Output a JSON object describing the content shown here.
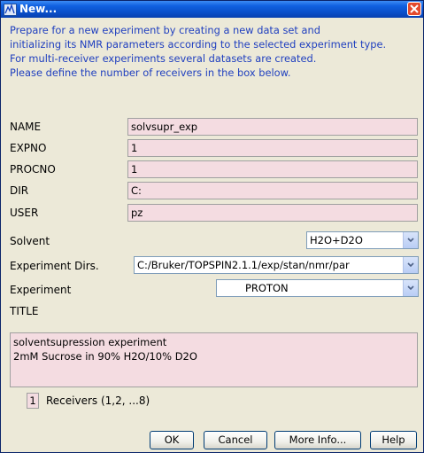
{
  "window": {
    "title": "New..."
  },
  "intro": {
    "lines": [
      "Prepare for a new experiment by creating a new data set and",
      "initializing its NMR parameters according to the selected experiment type.",
      "For multi-receiver experiments several datasets are created.",
      "Please define the number of receivers in the box below."
    ]
  },
  "form": {
    "name": {
      "label": "NAME",
      "value": "solvsupr_exp"
    },
    "expno": {
      "label": "EXPNO",
      "value": "1"
    },
    "procno": {
      "label": "PROCNO",
      "value": "1"
    },
    "dir": {
      "label": "DIR",
      "value": "C:"
    },
    "user": {
      "label": "USER",
      "value": "pz"
    },
    "solvent": {
      "label": "Solvent",
      "value": "H2O+D2O"
    },
    "experiment_dirs": {
      "label": "Experiment Dirs.",
      "value": "C:/Bruker/TOPSPIN2.1.1/exp/stan/nmr/par"
    },
    "experiment": {
      "label": "Experiment",
      "value": "PROTON"
    },
    "title": {
      "label": "TITLE",
      "lines": [
        "solventsupression experiment",
        "2mM Sucrose in 90% H2O/10% D2O"
      ]
    },
    "receivers": {
      "value": "1",
      "label": "Receivers (1,2, ...8)"
    }
  },
  "buttons": {
    "ok": "OK",
    "cancel": "Cancel",
    "more_info": "More Info...",
    "help": "Help"
  },
  "colors": {
    "title_bar": "#0a4ec8",
    "intro_text": "#1f3fbf",
    "field_bg": "#f4dce1",
    "dialog_bg": "#ece9d8"
  }
}
